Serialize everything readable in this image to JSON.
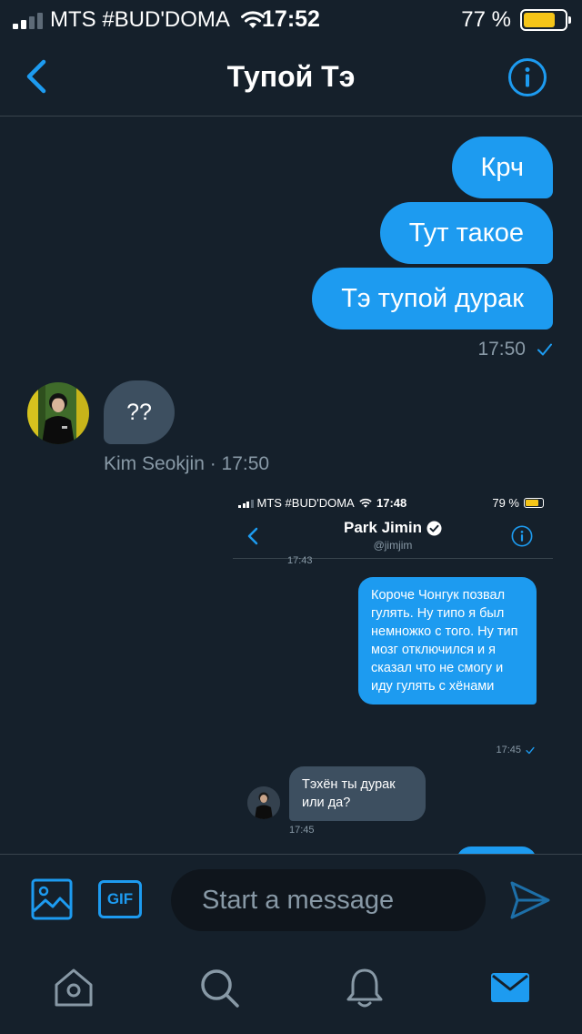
{
  "status_bar": {
    "carrier": "MTS #BUD'DOMA",
    "time": "17:52",
    "battery": "77 %",
    "battery_level": 0.77
  },
  "header": {
    "title": "Тупой Тэ"
  },
  "messages_out": [
    {
      "text": "Крч"
    },
    {
      "text": "Тут такое"
    },
    {
      "text": "Тэ тупой дурак"
    }
  ],
  "out_meta": {
    "time": "17:50"
  },
  "message_in": {
    "text": "??",
    "meta": "Kim Seokjin · 17:50"
  },
  "embedded_screenshot": {
    "status": {
      "carrier": "MTS #BUD'DOMA",
      "time": "17:48",
      "battery": "79 %",
      "battery_level": 0.79
    },
    "contact_name": "Park Jimin",
    "contact_handle": "@jimjim",
    "time_top": "17:43",
    "outgoing_text": "Короче Чонгук позвал гулять. Ну типо я был немножко с того. Ну тип мозг отключился и я сказал что не смогу и иду гулять с хёнами",
    "outgoing_time": "17:45",
    "incoming_text": "Тэхён ты дурак или да?",
    "incoming_time": "17:45"
  },
  "composer": {
    "gif_label": "GIF",
    "placeholder": "Start a message"
  },
  "colors": {
    "background": "#15202b",
    "accent": "#1d9bf0",
    "incoming_bubble": "#3d4f60",
    "muted_text": "#8899a6",
    "battery": "#f5c518"
  },
  "icons": [
    "back-chevron-icon",
    "info-icon",
    "wifi-icon",
    "battery-icon",
    "read-check-icon",
    "image-icon",
    "gif-icon",
    "send-icon",
    "home-icon",
    "search-icon",
    "bell-icon",
    "mail-icon",
    "verified-badge-icon"
  ]
}
